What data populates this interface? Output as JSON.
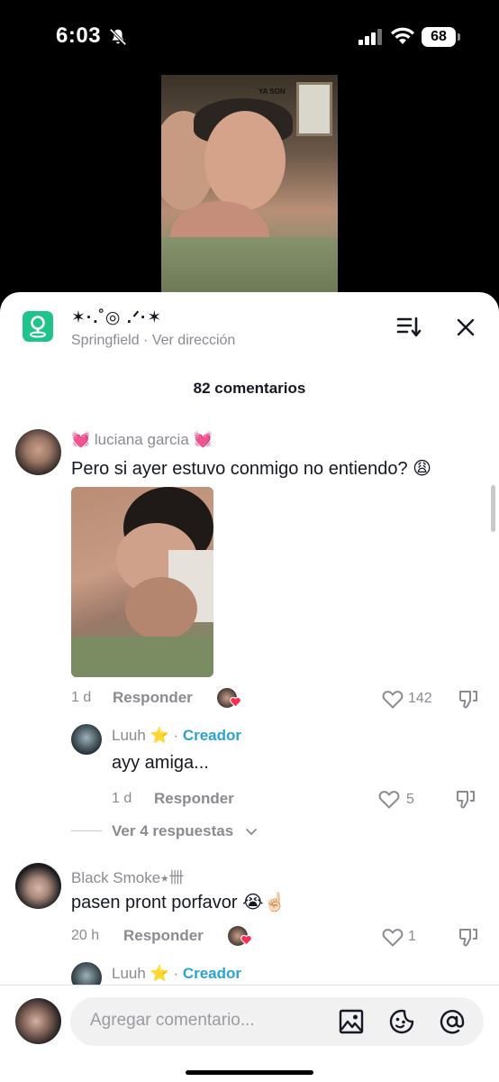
{
  "status_bar": {
    "time": "6:03",
    "battery": "68"
  },
  "video": {
    "watermark": "YA SON"
  },
  "header": {
    "location_title": "✶·.˚◎ .ᐟ·✶",
    "location_city": "Springfield",
    "location_separator": " · ",
    "location_link": "Ver dirección"
  },
  "comment_count": "82 comentarios",
  "comments": [
    {
      "username": "💓 luciana garcia 💓",
      "text": "Pero si ayer estuvo conmigo no entiendo? 😩",
      "time": "1 d",
      "reply_label": "Responder",
      "likes": "142",
      "replies": [
        {
          "username": "Luuh ⭐",
          "separator": " · ",
          "badge": "Creador",
          "text": "ayy amiga...",
          "time": "1 d",
          "reply_label": "Responder",
          "likes": "5"
        }
      ],
      "view_replies": "Ver 4 respuestas"
    },
    {
      "username": "Black Smoke⭑卌",
      "text": "pasen pront porfavor 😭☝🏻",
      "time": "20 h",
      "reply_label": "Responder",
      "likes": "1",
      "replies": [
        {
          "username": "Luuh ⭐",
          "separator": " · ",
          "badge": "Creador"
        }
      ]
    }
  ],
  "input": {
    "placeholder": "Agregar comentario..."
  },
  "colors": {
    "accent_creator": "#2aa4d0",
    "location_icon": "#20c48a",
    "like_heart": "#fe2c55"
  }
}
